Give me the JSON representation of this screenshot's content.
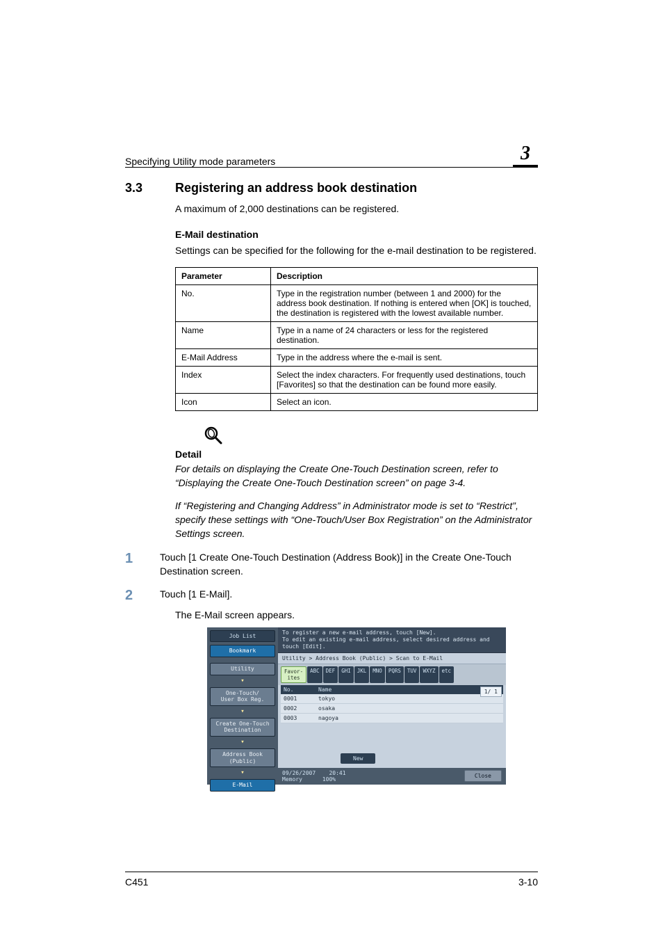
{
  "header": {
    "running_title": "Specifying Utility mode parameters",
    "chapter_number": "3"
  },
  "section": {
    "number": "3.3",
    "title": "Registering an address book destination",
    "intro": "A maximum of 2,000 destinations can be registered."
  },
  "subsection": {
    "heading": "E-Mail destination",
    "intro": "Settings can be specified for the following for the e-mail destination to be registered."
  },
  "table": {
    "head_param": "Parameter",
    "head_desc": "Description",
    "rows": [
      {
        "param": "No.",
        "desc": "Type in the registration number (between 1 and 2000) for the address book destination. If nothing is entered when [OK] is touched, the destination is registered with the lowest available number."
      },
      {
        "param": "Name",
        "desc": "Type in a name of 24 characters or less for the registered destination."
      },
      {
        "param": "E-Mail Address",
        "desc": "Type in the address where the e-mail is sent."
      },
      {
        "param": "Index",
        "desc": "Select the index characters. For frequently used destinations, touch [Favorites] so that the destination can be found more easily."
      },
      {
        "param": "Icon",
        "desc": "Select an icon."
      }
    ]
  },
  "detail": {
    "label": "Detail",
    "p1": "For details on displaying the Create One-Touch Destination screen, refer to “Displaying the Create One-Touch Destination screen” on page 3-4.",
    "p2": "If “Registering and Changing Address” in Administrator mode is set to “Restrict”, specify these settings with “One-Touch/User Box Registration” on the Administrator Settings screen."
  },
  "steps": {
    "s1_num": "1",
    "s1_text": "Touch [1 Create One-Touch Destination (Address Book)] in the Create One-Touch Destination screen.",
    "s2_num": "2",
    "s2_text": "Touch [1 E-Mail].",
    "s2_result": "The E-Mail screen appears."
  },
  "screen": {
    "left": {
      "job_list": "Job List",
      "bookmark": "Bookmark",
      "utility": "Utility",
      "one_touch": "One-Touch/\nUser Box Reg.",
      "create": "Create One-Touch\nDestination",
      "address_book": "Address Book\n(Public)",
      "email": "E-Mail"
    },
    "topmsg_l1": "To register a new e-mail address, touch [New].",
    "topmsg_l2": "To edit an existing e-mail address, select desired address and touch [Edit].",
    "breadcrumb": "Utility > Address Book (Public) > Scan to E-Mail",
    "tabs": [
      "Favor-\nites",
      "ABC",
      "DEF",
      "GHI",
      "JKL",
      "MNO",
      "PQRS",
      "TUV",
      "WXYZ",
      "etc"
    ],
    "list_head_no": "No.",
    "list_head_name": "Name",
    "rows": [
      {
        "no": "0001",
        "name": "tokyo"
      },
      {
        "no": "0002",
        "name": "osaka"
      },
      {
        "no": "0003",
        "name": "nagoya"
      }
    ],
    "pager": "1/  1",
    "new_btn": "New",
    "footer_date": "09/26/2007",
    "footer_time": "20:41",
    "footer_mem_label": "Memory",
    "footer_mem_val": "100%",
    "close": "Close"
  },
  "footer": {
    "model": "C451",
    "page": "3-10"
  }
}
